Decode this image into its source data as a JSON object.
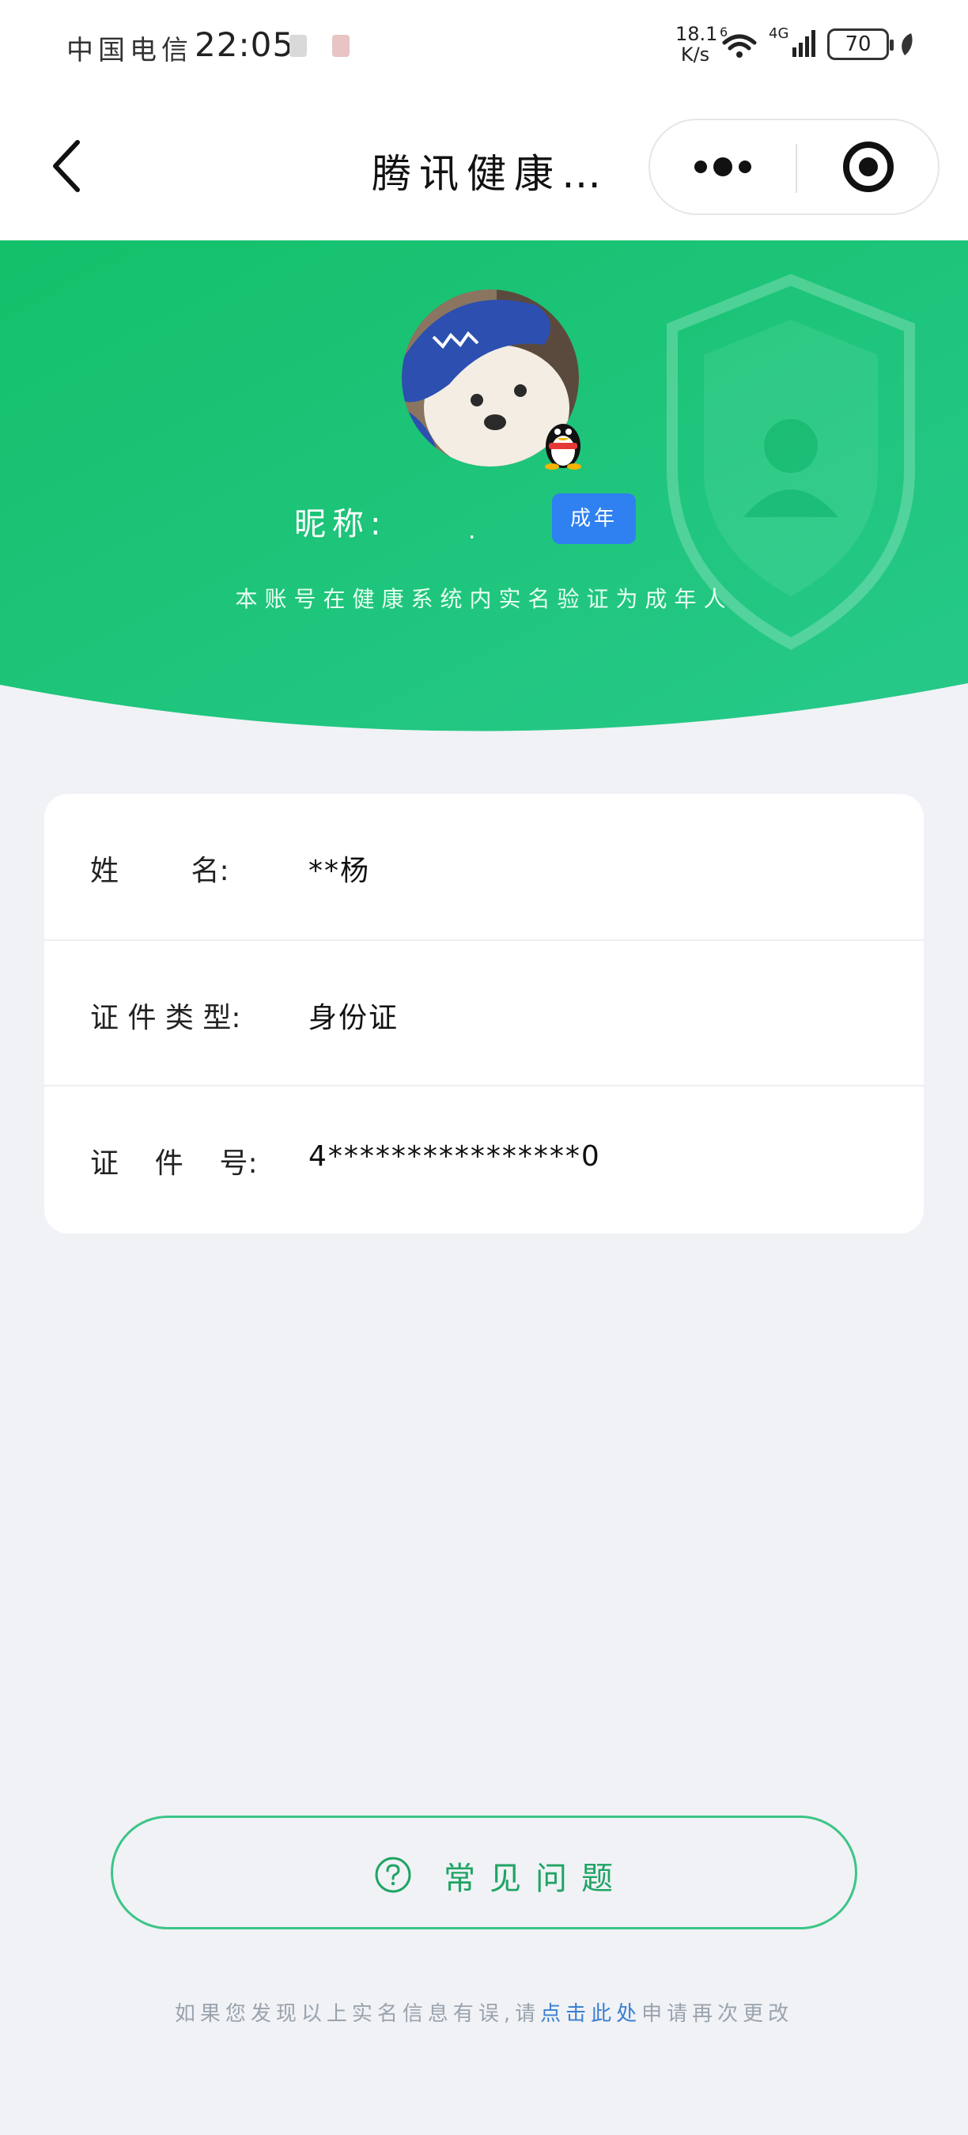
{
  "status_bar": {
    "carrier": "中国电信",
    "time": "22:05",
    "net_speed_value": "18.1",
    "net_speed_unit": "K/s",
    "wifi_label": "6",
    "cellular_label": "4G",
    "battery": "70",
    "icons": [
      "wifi-icon",
      "signal-icon",
      "battery-icon",
      "leaf-icon"
    ]
  },
  "nav": {
    "title": "腾讯健康…",
    "icons": [
      "back-arrow-icon",
      "more-dots-icon",
      "close-target-icon"
    ]
  },
  "profile": {
    "nickname_label": "昵称:",
    "nickname_value": ".",
    "age_badge": "成年",
    "verified_note": "本账号在健康系统内实名验证为成年人",
    "colors": {
      "header_green": "#1dbf6e",
      "badge_blue": "#2f80f0"
    }
  },
  "info": {
    "rows": [
      {
        "label": "姓        名:",
        "value": "**杨"
      },
      {
        "label": "证 件 类 型:",
        "value": "身份证"
      },
      {
        "label": "证    件    号:",
        "value": "4****************0"
      }
    ]
  },
  "faq": {
    "label": "常见问题",
    "icon": "question-circle-icon",
    "accent": "#1fa463"
  },
  "footer": {
    "prefix": "如果您发现以上实名信息有误,请",
    "link": "点击此处",
    "suffix": "申请再次更改"
  }
}
